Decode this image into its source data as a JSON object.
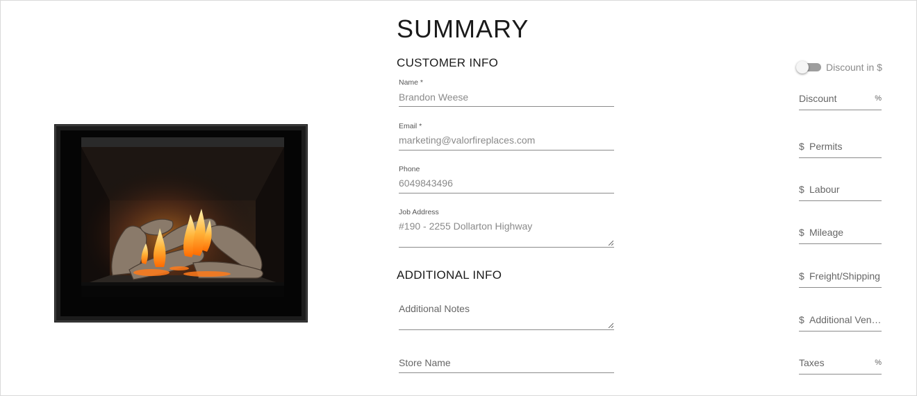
{
  "page": {
    "title": "SUMMARY"
  },
  "customer_info": {
    "heading": "CUSTOMER INFO",
    "fields": {
      "name": {
        "label": "Name *",
        "value": "Brandon Weese"
      },
      "email": {
        "label": "Email *",
        "value": "marketing@valorfireplaces.com"
      },
      "phone": {
        "label": "Phone",
        "value": "6049843496"
      },
      "job_address": {
        "label": "Job Address",
        "value": "#190 - 2255 Dollarton Highway"
      }
    }
  },
  "additional_info": {
    "heading": "ADDITIONAL INFO",
    "fields": {
      "notes": {
        "placeholder": "Additional Notes"
      },
      "store": {
        "placeholder": "Store Name"
      }
    }
  },
  "pricing": {
    "discount_toggle": {
      "label": "Discount in $",
      "on": false
    },
    "discount": {
      "label": "Discount",
      "suffix": "%"
    },
    "permits": {
      "prefix": "$",
      "label": "Permits"
    },
    "labour": {
      "prefix": "$",
      "label": "Labour"
    },
    "mileage": {
      "prefix": "$",
      "label": "Mileage"
    },
    "freight": {
      "prefix": "$",
      "label": "Freight/Shipping"
    },
    "venting": {
      "prefix": "$",
      "label": "Additional Venting"
    },
    "taxes": {
      "label": "Taxes",
      "suffix": "%"
    }
  },
  "colors": {
    "underline": "#8a8a8a",
    "text_muted": "#8a8a8a",
    "toggle_track": "#9e9e9e"
  }
}
